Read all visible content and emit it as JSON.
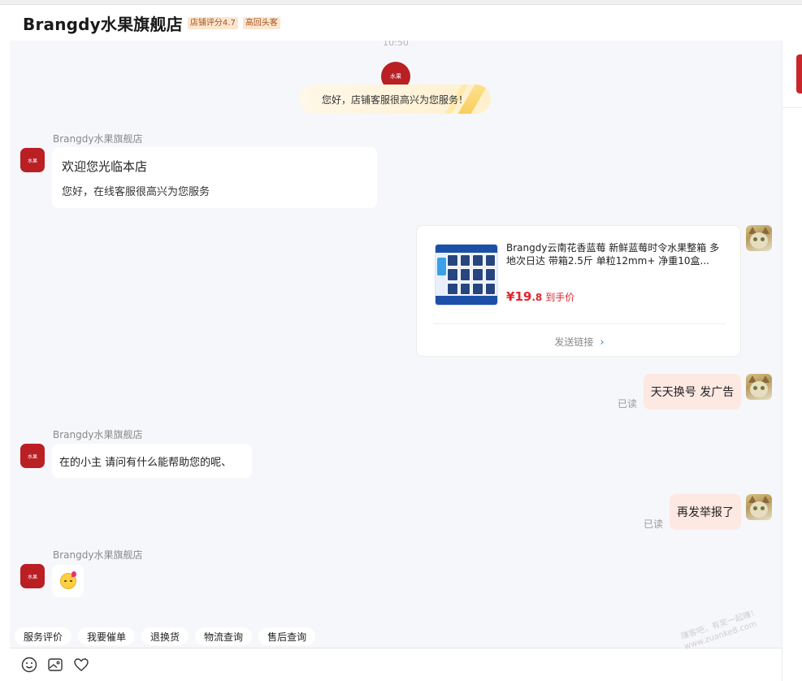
{
  "header": {
    "shop_name": "Brangdy水果旗舰店",
    "badges": [
      "店铺评分4.7",
      "高回头客"
    ]
  },
  "chat": {
    "time": "10:50",
    "system_avatar_text": "水果",
    "system_message": "您好，店铺客服很高兴为您服务！",
    "shop_avatar_text": "水果",
    "messages": {
      "welcome": {
        "sender": "Brangdy水果旗舰店",
        "title": "欢迎您光临本店",
        "subtitle": "您好，在线客服很高兴为您服务"
      },
      "product_card": {
        "title": "Brangdy云南花香蓝莓 新鲜蓝莓时令水果整箱 多地次日达 带箱2.5斤 单粒12mm+ 净重10盒...",
        "price_symbol": "¥",
        "price_main": "19",
        "price_cents": ".8",
        "price_label": "到手价",
        "link_label": "发送链接"
      },
      "user_msg_1": {
        "text": "天天换号 发广告",
        "status": "已读"
      },
      "reply_1": {
        "sender": "Brangdy水果旗舰店",
        "text": "在的小主 请问有什么能帮助您的呢、"
      },
      "user_msg_2": {
        "text": "再发举报了",
        "status": "已读"
      },
      "emoji_msg": {
        "sender": "Brangdy水果旗舰店"
      }
    }
  },
  "quick_actions": [
    "服务评价",
    "我要催单",
    "退换货",
    "物流查询",
    "售后查询"
  ],
  "toolbar": {
    "icons": [
      "emoji-icon",
      "image-icon",
      "heart-icon"
    ]
  },
  "watermark": {
    "line1": "赚客吧，有奖一起赚！",
    "line2": "www.zuanke8.com"
  },
  "colors": {
    "brand_red": "#b91f23",
    "price_red": "#e4232d",
    "my_bubble": "#fde8e2",
    "chat_bg": "#f6f7fb"
  }
}
